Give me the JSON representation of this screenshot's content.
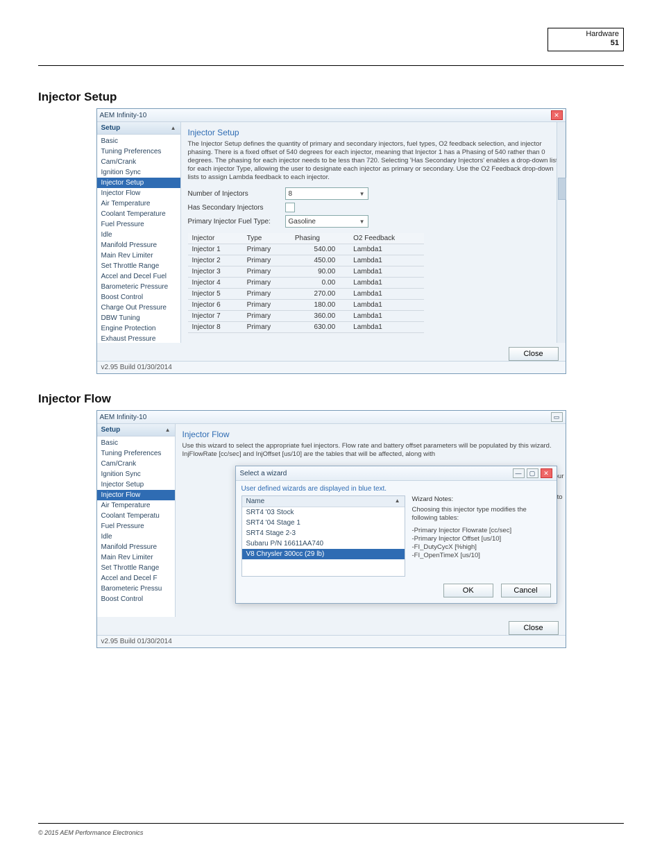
{
  "header": {
    "title_text": "Hardware",
    "page_label": "51"
  },
  "sections": {
    "injector_setup_heading": "Injector Setup",
    "injector_flow_heading": "Injector Flow"
  },
  "window1": {
    "title": "AEM Infinity-10",
    "sidebar_header": "Setup",
    "sidebar_items": [
      "Basic",
      "Tuning Preferences",
      "Cam/Crank",
      "Ignition Sync",
      "Injector Setup",
      "Injector Flow",
      "Air Temperature",
      "Coolant Temperature",
      "Fuel Pressure",
      "Idle",
      "Manifold Pressure",
      "Main Rev Limiter",
      "Set Throttle Range",
      "Accel and Decel Fuel",
      "Barometeric Pressure",
      "Boost Control",
      "Charge Out Pressure",
      "DBW Tuning",
      "Engine Protection",
      "Exhaust Pressure"
    ],
    "active_index": 4,
    "pane_title": "Injector Setup",
    "pane_desc": "The Injector Setup defines the quantity of primary and secondary injectors, fuel types, O2 feedback selection, and injector phasing. There is a fixed offset of 540 degrees for each injector, meaning that Injector 1 has a Phasing of 540 rather than 0 degrees. The phasing for each injector needs to be less than 720. Selecting 'Has Secondary Injectors' enables a drop-down list for each injector Type, allowing the user to designate each injector as primary or secondary. Use the O2 Feedback drop-down lists to assign Lambda feedback to each injector.",
    "num_injectors_label": "Number of Injectors",
    "num_injectors_value": "8",
    "has_secondary_label": "Has Secondary Injectors",
    "fuel_type_label": "Primary Injector Fuel Type:",
    "fuel_type_value": "Gasoline",
    "table": {
      "headers": [
        "Injector",
        "Type",
        "Phasing",
        "O2 Feedback"
      ],
      "rows": [
        [
          "Injector 1",
          "Primary",
          "540.00",
          "Lambda1"
        ],
        [
          "Injector 2",
          "Primary",
          "450.00",
          "Lambda1"
        ],
        [
          "Injector 3",
          "Primary",
          "90.00",
          "Lambda1"
        ],
        [
          "Injector 4",
          "Primary",
          "0.00",
          "Lambda1"
        ],
        [
          "Injector 5",
          "Primary",
          "270.00",
          "Lambda1"
        ],
        [
          "Injector 6",
          "Primary",
          "180.00",
          "Lambda1"
        ],
        [
          "Injector 7",
          "Primary",
          "360.00",
          "Lambda1"
        ],
        [
          "Injector 8",
          "Primary",
          "630.00",
          "Lambda1"
        ]
      ]
    },
    "close_label": "Close",
    "status": "v2.95 Build 01/30/2014"
  },
  "window2": {
    "title": "AEM Infinity-10",
    "sidebar_header": "Setup",
    "sidebar_items": [
      "Basic",
      "Tuning Preferences",
      "Cam/Crank",
      "Ignition Sync",
      "Injector Setup",
      "Injector Flow",
      "Air Temperature",
      "Coolant Temperatu",
      "Fuel Pressure",
      "Idle",
      "Manifold Pressure",
      "Main Rev Limiter",
      "Set Throttle Range",
      "Accel and Decel F",
      "Barometeric Pressu",
      "Boost Control"
    ],
    "active_index": 5,
    "pane_title": "Injector Flow",
    "pane_desc": "Use this wizard to select the appropriate fuel injectors. Flow rate and battery offset parameters will be populated by this wizard. InjFlowRate [cc/sec] and InjOffset [us/10] are the tables that will be affected, along with",
    "modal_bar": "Select a wizard",
    "blue_hint": "User defined wizards are displayed in blue text.",
    "list_header": "Name",
    "list_items": [
      "SRT4 '03 Stock",
      "SRT4 '04 Stage 1",
      "SRT4 Stage 2-3",
      "Subaru P/N 16611AA740",
      "V8 Chrysler 300cc (29 lb)"
    ],
    "list_active_index": 4,
    "notes_title": "Wizard Notes:",
    "notes_body": "Choosing this injector type modifies the following tables:",
    "notes_lines": [
      "-Primary Injector Flowrate [cc/sec]",
      "-Primary Injector Offset [us/10]",
      "-FI_DutyCycX [%high]",
      "-FI_OpenTimeX [us/10]"
    ],
    "ok_label": "OK",
    "cancel_label": "Cancel",
    "close_label": "Close",
    "status": "v2.95 Build 01/30/2014",
    "trailing_text_1": "your",
    "trailing_text_2": "to"
  },
  "footer": {
    "copyright": "© 2015 AEM Performance Electronics"
  }
}
